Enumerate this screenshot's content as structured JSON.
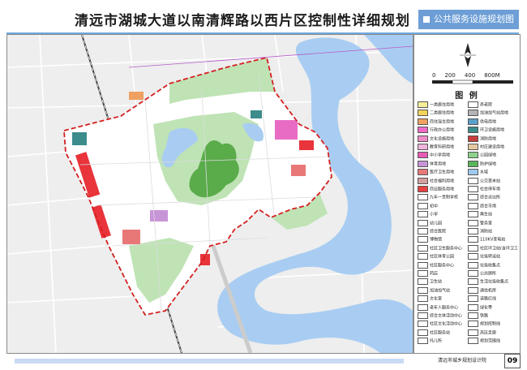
{
  "header": {
    "title": "清远市湖城大道以南清辉路以西片区控制性详细规划",
    "badge": "公共服务设施规划图"
  },
  "scale": {
    "ticks": [
      "0",
      "200",
      "400",
      "800M"
    ]
  },
  "legend": {
    "title": "图 例",
    "items": [
      {
        "label": "一类居住用地",
        "color": "#f6ef9a"
      },
      {
        "label": "二类居住用地",
        "color": "#f3d35b"
      },
      {
        "label": "商住混合用地",
        "color": "#f0a060"
      },
      {
        "label": "行政办公用地",
        "color": "#f06ac8"
      },
      {
        "label": "文化设施用地",
        "color": "#f08cc8"
      },
      {
        "label": "教育科研用地",
        "color": "#f0b4dc"
      },
      {
        "label": "中小学用地",
        "color": "#e85cb4"
      },
      {
        "label": "体育用地",
        "color": "#c894d8"
      },
      {
        "label": "医疗卫生用地",
        "color": "#e87878"
      },
      {
        "label": "社会福利用地",
        "color": "#d4a0a0"
      },
      {
        "label": "商业服务用地",
        "color": "#e84040"
      },
      {
        "label": "九年一贯制学校",
        "color": "#ffffff"
      },
      {
        "label": "初中",
        "color": "#ffffff"
      },
      {
        "label": "小学",
        "color": "#ffffff"
      },
      {
        "label": "幼儿园",
        "color": "#ffffff"
      },
      {
        "label": "综合医院",
        "color": "#ffffff"
      },
      {
        "label": "博物馆",
        "color": "#ffffff"
      },
      {
        "label": "社区卫生服务中心",
        "color": "#ffffff"
      },
      {
        "label": "社区体育公园",
        "color": "#ffffff"
      },
      {
        "label": "社区服务中心",
        "color": "#ffffff"
      },
      {
        "label": "药店",
        "color": "#ffffff"
      },
      {
        "label": "卫生站",
        "color": "#ffffff"
      },
      {
        "label": "加油加气站",
        "color": "#ffffff"
      },
      {
        "label": "文化室",
        "color": "#ffffff"
      },
      {
        "label": "老年人服务中心",
        "color": "#ffffff"
      },
      {
        "label": "综合文体活动中心",
        "color": "#ffffff"
      },
      {
        "label": "社区文化活动中心",
        "color": "#ffffff"
      },
      {
        "label": "社区服务站",
        "color": "#ffffff"
      },
      {
        "label": "托儿所",
        "color": "#ffffff"
      },
      {
        "label": "养老院",
        "color": "#ffffff"
      },
      {
        "label": "加油加气站用地",
        "color": "#b4b4b4"
      },
      {
        "label": "供电用地",
        "color": "#5aa0c8"
      },
      {
        "label": "环卫设施用地",
        "color": "#3c8c8c"
      },
      {
        "label": "消防用地",
        "color": "#c83c3c"
      },
      {
        "label": "村庄建设用地",
        "color": "#e6c8a0"
      },
      {
        "label": "公园绿地",
        "color": "#8cd28c"
      },
      {
        "label": "防护绿地",
        "color": "#5ab45a"
      },
      {
        "label": "水域",
        "color": "#a0c8f0"
      },
      {
        "label": "公交首末站",
        "color": "#ffffff"
      },
      {
        "label": "社会停车场",
        "color": "#ffffff"
      },
      {
        "label": "综合派出所",
        "color": "#ffffff"
      },
      {
        "label": "综合市场",
        "color": "#ffffff"
      },
      {
        "label": "再生站",
        "color": "#ffffff"
      },
      {
        "label": "警务室",
        "color": "#ffffff"
      },
      {
        "label": "消防站",
        "color": "#ffffff"
      },
      {
        "label": "110KV变电站",
        "color": "#ffffff"
      },
      {
        "label": "社区环卫站(含环卫工休息)",
        "color": "#ffffff"
      },
      {
        "label": "垃圾转运站",
        "color": "#ffffff"
      },
      {
        "label": "垃圾收集点",
        "color": "#ffffff"
      },
      {
        "label": "公共厕所",
        "color": "#ffffff"
      },
      {
        "label": "生活垃圾收集点",
        "color": "#ffffff"
      },
      {
        "label": "通信机房",
        "color": "#ffffff"
      },
      {
        "label": "道路红线",
        "color": "#ffffff"
      },
      {
        "label": "绿化带",
        "color": "#ffffff"
      },
      {
        "label": "铁路",
        "color": "#ffffff"
      },
      {
        "label": "规划控制线",
        "color": "#ffffff"
      },
      {
        "label": "高压走廊",
        "color": "#ffffff"
      },
      {
        "label": "规划范围线",
        "color": "#ffffff"
      }
    ]
  },
  "map": {
    "colors": {
      "water": "#a9cdf2",
      "park": "#bfe3b5",
      "forest": "#5aab4a",
      "residential": "#ffffff",
      "commercial": "#e8343a",
      "education": "#e86cc4",
      "boundary": "#d42020",
      "base": "#e8e8e8"
    }
  },
  "footer": {
    "org": "清远市城乡规划设计院",
    "page": "09"
  }
}
